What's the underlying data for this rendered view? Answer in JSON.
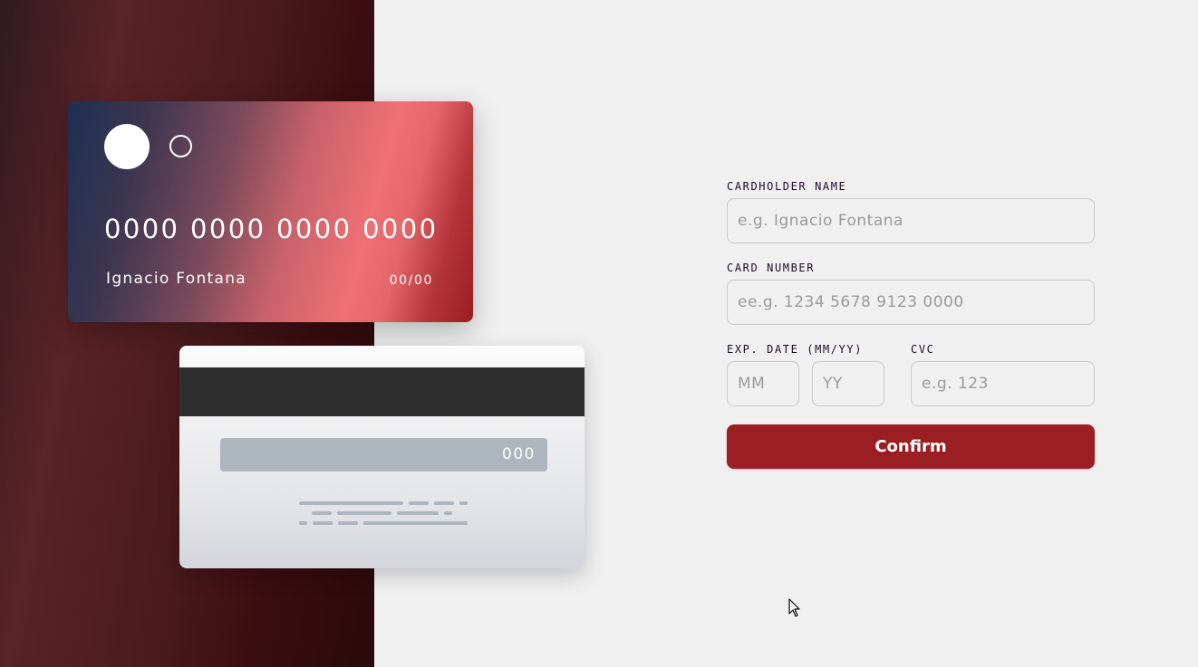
{
  "card_front": {
    "number": "0000 0000 0000 0000",
    "name": "Ignacio Fontana",
    "expiry": "00/00"
  },
  "card_back": {
    "cvc": "000"
  },
  "form": {
    "cardholder_label": "CARDHOLDER NAME",
    "cardholder_placeholder": "e.g. Ignacio Fontana",
    "card_number_label": "CARD NUMBER",
    "card_number_placeholder": "ee.g. 1234 5678 9123 0000",
    "exp_label": "EXP. DATE (MM/YY)",
    "month_placeholder": "MM",
    "year_placeholder": "YY",
    "cvc_label": "CVC",
    "cvc_placeholder": "e.g. 123",
    "confirm_label": "Confirm"
  },
  "colors": {
    "accent": "#9b1e23",
    "background": "#f0f0f0",
    "label_text": "#21092f"
  },
  "icons": {
    "card_logo_large": "filled-circle-icon",
    "card_logo_small": "ring-icon",
    "cursor": "mouse-pointer-icon"
  }
}
